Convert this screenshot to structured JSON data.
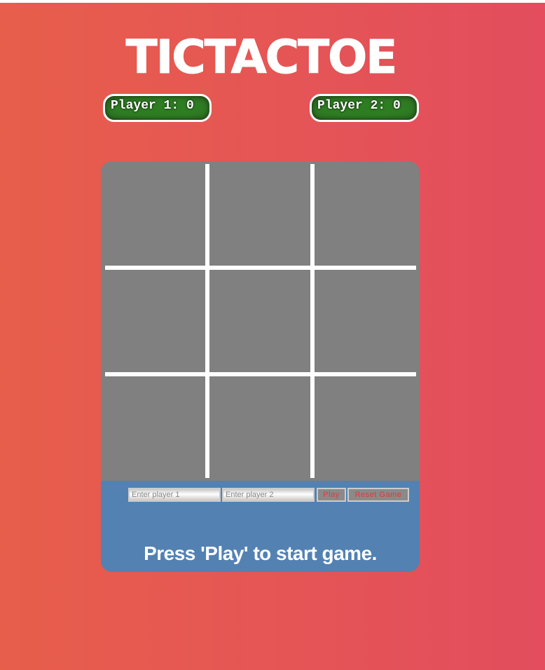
{
  "title": "TICTACTOE",
  "scores": {
    "player1": "Player 1: 0",
    "player2": "Player 2: 0"
  },
  "board": {
    "cells": [
      "",
      "",
      "",
      "",
      "",
      "",
      "",
      "",
      ""
    ]
  },
  "controls": {
    "player1_placeholder": "Enter player 1",
    "player2_placeholder": "Enter player 2",
    "play_label": "Play",
    "reset_label": "Reset Game"
  },
  "status": "Press 'Play' to start game.",
  "colors": {
    "background_left": "#e75e4b",
    "background_right": "#e34d5e",
    "board": "#808080",
    "controls_panel": "#5381b2",
    "score_badge": "#2e7d22",
    "button_text": "#e03a3a"
  }
}
